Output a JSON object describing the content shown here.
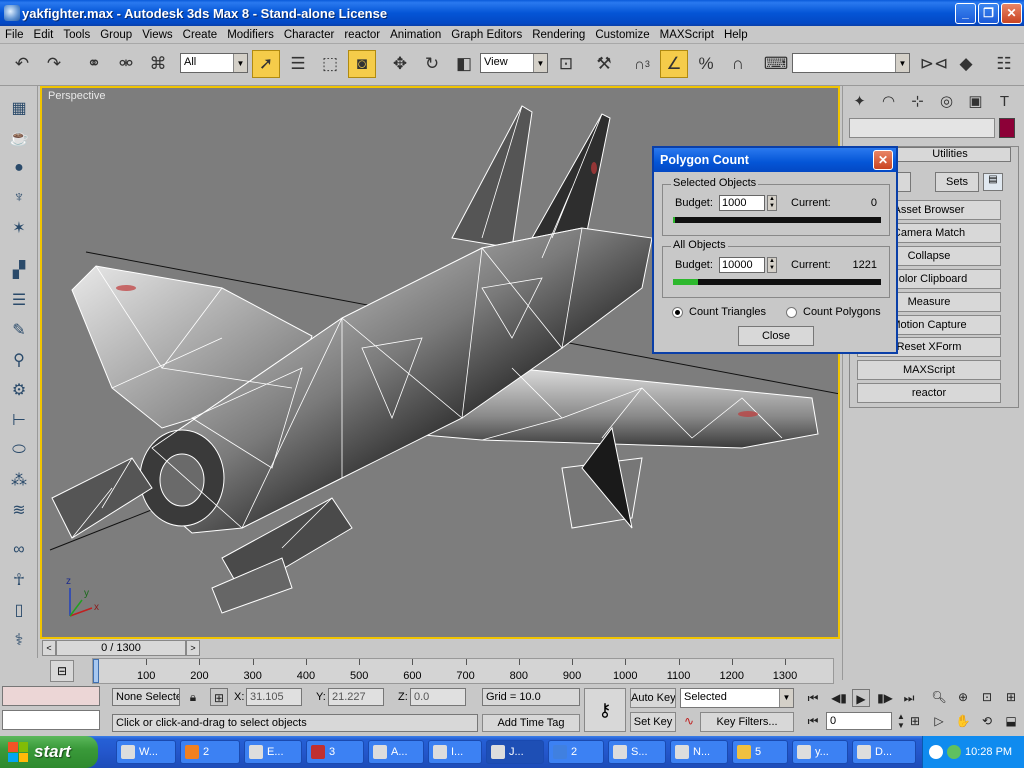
{
  "window": {
    "title": "yakfighter.max - Autodesk 3ds Max 8  - Stand-alone License",
    "minimize": "_",
    "maximize": "❐",
    "close": "✕"
  },
  "menu": [
    "File",
    "Edit",
    "Tools",
    "Group",
    "Views",
    "Create",
    "Modifiers",
    "Character",
    "reactor",
    "Animation",
    "Graph Editors",
    "Rendering",
    "Customize",
    "MAXScript",
    "Help"
  ],
  "toolbar": {
    "selection_filter": "All",
    "reference_coord": "View",
    "snap_count": "3",
    "named_selection": ""
  },
  "viewport": {
    "label": "Perspective",
    "axes": {
      "x": "x",
      "y": "y",
      "z": "z"
    }
  },
  "command_panel": {
    "rollout_title": "Utilities",
    "sets_label": "Sets",
    "buttons": [
      "Asset Browser",
      "Camera Match",
      "Collapse",
      "Color Clipboard",
      "Measure",
      "Motion Capture",
      "Reset XForm",
      "MAXScript",
      "reactor"
    ],
    "object_color": "#8c0037"
  },
  "dialog": {
    "title": "Polygon Count",
    "selected": {
      "group_label": "Selected Objects",
      "budget_label": "Budget:",
      "budget": "1000",
      "current_label": "Current:",
      "current": "0",
      "fill": 0.01
    },
    "all": {
      "group_label": "All Objects",
      "budget_label": "Budget:",
      "budget": "10000",
      "current_label": "Current:",
      "current": "1221",
      "fill": 0.12
    },
    "radio_triangles": "Count Triangles",
    "radio_polygons": "Count Polygons",
    "close_label": "Close"
  },
  "timeline": {
    "frame": "0 / 1300",
    "ticks": [
      "0",
      "100",
      "200",
      "300",
      "400",
      "500",
      "600",
      "700",
      "800",
      "900",
      "1000",
      "1100",
      "1200",
      "1300"
    ]
  },
  "status": {
    "selection": "None Selecte",
    "x_label": "X:",
    "x": "31.105",
    "y_label": "Y:",
    "y": "21.227",
    "z_label": "Z:",
    "z": "0.0",
    "grid": "Grid = 10.0",
    "prompt": "Click or click-and-drag to select objects",
    "add_time_tag": "Add Time Tag",
    "auto_key": "Auto Key",
    "set_key": "Set Key",
    "key_mode": "Selected",
    "key_filters": "Key Filters...",
    "current_frame": "0"
  },
  "taskbar": {
    "start": "start",
    "tasks": [
      "W...",
      "2",
      "E...",
      "3",
      "A...",
      "I...",
      "J...",
      "2",
      "S...",
      "N...",
      "5",
      "y...",
      "D..."
    ],
    "clock": "10:28 PM"
  }
}
